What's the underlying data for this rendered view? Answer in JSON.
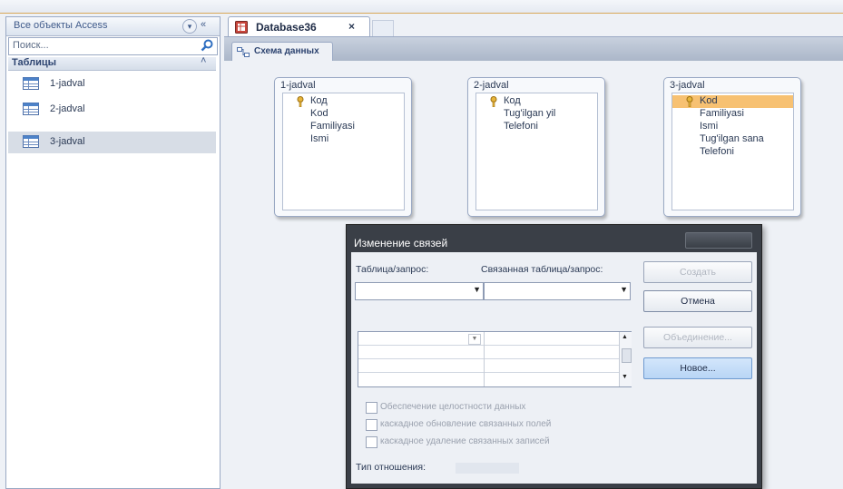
{
  "nav": {
    "title": "Все объекты Access",
    "search_placeholder": "Поиск...",
    "group_label": "Таблицы",
    "items": [
      {
        "label": "1-jadval"
      },
      {
        "label": "2-jadval"
      },
      {
        "label": "3-jadval"
      }
    ]
  },
  "document": {
    "tab_label": "Database36",
    "close_glyph": "×",
    "subtab_label": "Схема данных"
  },
  "tables": [
    {
      "title": "1-jadval",
      "fields": [
        "Код",
        "Kod",
        "Familiyasi",
        "Ismi"
      ],
      "key_index": 0,
      "selected_index": -1
    },
    {
      "title": "2-jadval",
      "fields": [
        "Код",
        "Tug'ilgan yil",
        "Telefoni"
      ],
      "key_index": 0,
      "selected_index": -1
    },
    {
      "title": "3-jadval",
      "fields": [
        "Kod",
        "Familiyasi",
        "Ismi",
        "Tug'ilgan sana",
        "Telefoni"
      ],
      "key_index": 0,
      "selected_index": 0
    }
  ],
  "dialog": {
    "title": "Изменение связей",
    "table_label": "Таблица/запрос:",
    "related_label": "Связанная таблица/запрос:",
    "buttons": {
      "create": "Создать",
      "cancel": "Отмена",
      "join": "Объединение...",
      "new": "Новое..."
    },
    "checkboxes": [
      "Обеспечение целостности данных",
      "каскадное обновление связанных полей",
      "каскадное удаление связанных записей"
    ],
    "relation_type_label": "Тип отношения:"
  },
  "colors": {
    "accent_highlight": "#f7c172",
    "dialog_frame": "#3a3f47",
    "hot_button": "#b8d5f5"
  }
}
